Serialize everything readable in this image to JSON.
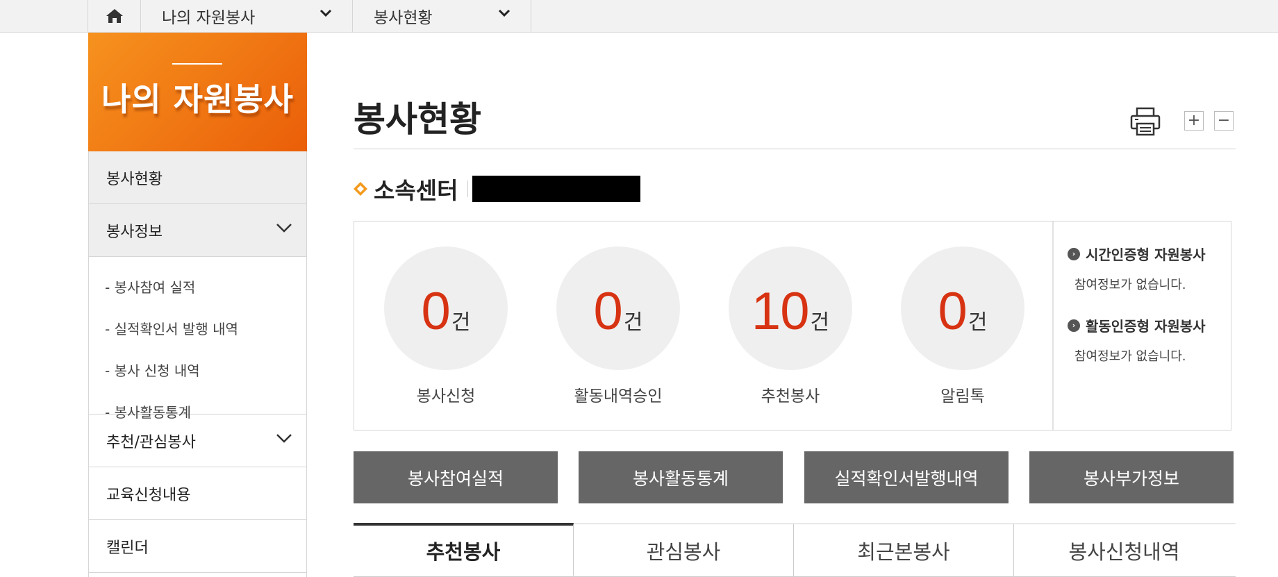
{
  "breadcrumb": {
    "home_icon": "home-icon",
    "level1": "나의 자원봉사",
    "level2": "봉사현황"
  },
  "sidebar": {
    "title": "나의 자원봉사",
    "items": [
      {
        "label": "봉사현황"
      },
      {
        "label": "봉사정보"
      },
      {
        "label": "추천/관심봉사"
      },
      {
        "label": "교육신청내용"
      },
      {
        "label": "캘린더"
      }
    ],
    "subitems": [
      {
        "label": "- 봉사참여 실적"
      },
      {
        "label": "- 실적확인서 발행 내역"
      },
      {
        "label": "- 봉사 신청 내역"
      },
      {
        "label": "- 봉사활동통계"
      }
    ]
  },
  "main": {
    "title": "봉사현황",
    "zoom_in": "+",
    "zoom_out": "−",
    "center_label": "소속센터"
  },
  "stats": [
    {
      "value": "0",
      "unit": "건",
      "label": "봉사신청"
    },
    {
      "value": "0",
      "unit": "건",
      "label": "활동내역승인"
    },
    {
      "value": "10",
      "unit": "건",
      "label": "추천봉사"
    },
    {
      "value": "0",
      "unit": "건",
      "label": "알림톡"
    }
  ],
  "info": [
    {
      "title": "시간인증형 자원봉사",
      "text": "참여정보가 없습니다."
    },
    {
      "title": "활동인증형 자원봉사",
      "text": "참여정보가 없습니다."
    }
  ],
  "actions": [
    {
      "label": "봉사참여실적"
    },
    {
      "label": "봉사활동통계"
    },
    {
      "label": "실적확인서발행내역"
    },
    {
      "label": "봉사부가정보"
    }
  ],
  "tabs": [
    {
      "label": "추천봉사"
    },
    {
      "label": "관심봉사"
    },
    {
      "label": "최근본봉사"
    },
    {
      "label": "봉사신청내역"
    }
  ],
  "colors": {
    "accent_orange": "#f07613",
    "number_red": "#d73313",
    "button_gray": "#666666"
  }
}
